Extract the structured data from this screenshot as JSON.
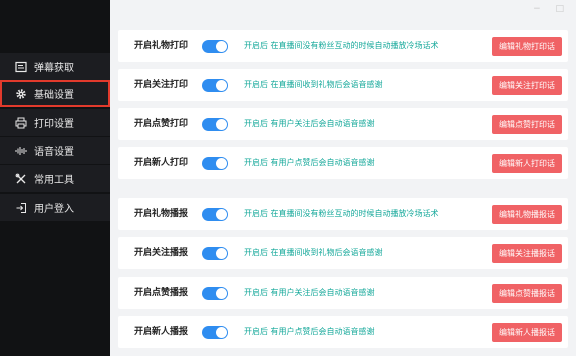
{
  "window_controls": "− □",
  "sidebar": {
    "items": [
      {
        "label": "弹幕获取",
        "icon": "barrage-icon"
      },
      {
        "label": "基础设置",
        "icon": "gear-icon",
        "active": true
      },
      {
        "label": "打印设置",
        "icon": "printer-icon"
      },
      {
        "label": "语音设置",
        "icon": "audio-wave-icon"
      },
      {
        "label": "常用工具",
        "icon": "tools-icon"
      },
      {
        "label": "用户登入",
        "icon": "login-icon"
      }
    ]
  },
  "print_section": [
    {
      "label": "开启礼物打印",
      "enabled": true,
      "desc": "开启后  在直播间没有粉丝互动的时候自动播放冷场话术",
      "button": "编辑礼物打印话"
    },
    {
      "label": "开启关注打印",
      "enabled": true,
      "desc": "开启后  在直播间收到礼物后会语音感谢",
      "button": "编辑关注打印话"
    },
    {
      "label": "开启点赞打印",
      "enabled": true,
      "desc": "开启后  有用户关注后会自动语音感谢",
      "button": "编辑点赞打印话"
    },
    {
      "label": "开启新人打印",
      "enabled": true,
      "desc": "开启后  有用户点赞后会自动语音感谢",
      "button": "编辑新人打印话"
    }
  ],
  "broadcast_section": [
    {
      "label": "开启礼物播报",
      "enabled": true,
      "desc": "开启后  在直播间没有粉丝互动的时候自动播放冷场话术",
      "button": "编辑礼物播报话"
    },
    {
      "label": "开启关注播报",
      "enabled": true,
      "desc": "开启后  在直播间收到礼物后会语音感谢",
      "button": "编辑关注播报话"
    },
    {
      "label": "开启点赞播报",
      "enabled": true,
      "desc": "开启后  有用户关注后会自动语音感谢",
      "button": "编辑点赞播报话"
    },
    {
      "label": "开启新人播报",
      "enabled": true,
      "desc": "开启后  有用户点赞后会自动语音感谢",
      "button": "编辑新人播报话"
    }
  ],
  "colors": {
    "accent": "#2f8df0",
    "button": "#f06265",
    "desc": "#15a89a",
    "sidebar": "#111214",
    "active_outline": "#e23a2c"
  }
}
